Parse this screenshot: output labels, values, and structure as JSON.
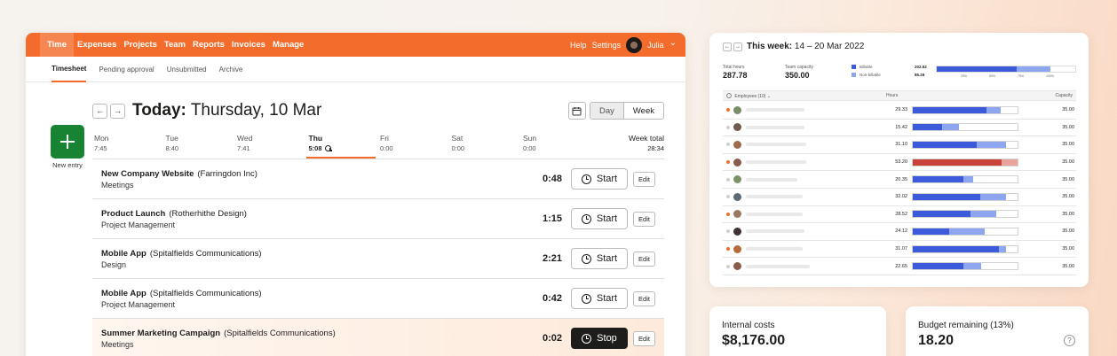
{
  "nav": {
    "tabs": [
      "Time",
      "Expenses",
      "Projects",
      "Team",
      "Reports",
      "Invoices",
      "Manage"
    ],
    "active_tab": "Time",
    "right": {
      "help": "Help",
      "settings": "Settings",
      "user": "Julia",
      "caret": "⌄"
    }
  },
  "subnav": {
    "items": [
      "Timesheet",
      "Pending approval",
      "Unsubmitted",
      "Archive"
    ],
    "active": "Timesheet"
  },
  "new_entry": {
    "label": "New entry"
  },
  "daybar": {
    "prev": "←",
    "next": "→",
    "today_label": "Today:",
    "date": "Thursday, 10 Mar",
    "view_day": "Day",
    "view_week": "Week"
  },
  "days": [
    {
      "name": "Mon",
      "time": "7:45"
    },
    {
      "name": "Tue",
      "time": "8:40"
    },
    {
      "name": "Wed",
      "time": "7:41"
    },
    {
      "name": "Thu",
      "time": "5:08"
    },
    {
      "name": "Fri",
      "time": "0:00"
    },
    {
      "name": "Sat",
      "time": "0:00"
    },
    {
      "name": "Sun",
      "time": "0:00"
    }
  ],
  "week_total": {
    "label": "Week total",
    "time": "28:34"
  },
  "entries": [
    {
      "project": "New Company Website",
      "client": "(Farringdon Inc)",
      "task": "Meetings",
      "duration": "0:48",
      "button": "Start",
      "edit": "Edit"
    },
    {
      "project": "Product Launch",
      "client": "(Rotherhithe Design)",
      "task": "Project Management",
      "duration": "1:15",
      "button": "Start",
      "edit": "Edit"
    },
    {
      "project": "Mobile App",
      "client": "(Spitalfields Communications)",
      "task": "Design",
      "duration": "2:21",
      "button": "Start",
      "edit": "Edit"
    },
    {
      "project": "Mobile App",
      "client": "(Spitalfields Communications)",
      "task": "Project Management",
      "duration": "0:42",
      "button": "Start",
      "edit": "Edit"
    },
    {
      "project": "Summer Marketing Campaign",
      "client": "(Spitalfields Communications)",
      "task": "Meetings",
      "duration": "0:02",
      "button": "Stop",
      "edit": "Edit"
    }
  ],
  "report": {
    "prev": "←",
    "next": "→",
    "title_bold": "This week:",
    "title_range": "14 – 20 Mar 2022",
    "total_hours_label": "Total hours",
    "total_hours": "287.78",
    "capacity_label": "Team capacity",
    "capacity": "350.00",
    "billable_label": "Billable",
    "billable": "202.52",
    "nonbillable_label": "Non-billable",
    "nonbillable": "85.26",
    "summary_ticks": [
      "25%",
      "50%",
      "75%",
      "100%"
    ],
    "summary_billable_pct": 57.9,
    "summary_nonbillable_pct": 24.4,
    "col_employees": "Employees (10)",
    "col_hours": "Hours",
    "col_capacity": "Capacity",
    "rows": [
      {
        "hours": "29.33",
        "capacity": "35.00",
        "billable": 0.7,
        "nonbillable": 0.14,
        "over": 0,
        "status": "#f36c2b",
        "name_w": 66
      },
      {
        "hours": "15.42",
        "capacity": "35.00",
        "billable": 0.28,
        "nonbillable": 0.16,
        "over": 0,
        "status": "#cfcfcf",
        "name_w": 66
      },
      {
        "hours": "31.10",
        "capacity": "35.00",
        "billable": 0.61,
        "nonbillable": 0.28,
        "over": 0,
        "status": "#cfcfcf",
        "name_w": 68
      },
      {
        "hours": "53.20",
        "capacity": "35.00",
        "billable": 0.85,
        "nonbillable": 0,
        "over": 0.15,
        "status": "#f36c2b",
        "name_w": 68
      },
      {
        "hours": "20.35",
        "capacity": "35.00",
        "billable": 0.48,
        "nonbillable": 0.1,
        "over": 0,
        "status": "#cfcfcf",
        "name_w": 58
      },
      {
        "hours": "32.02",
        "capacity": "35.00",
        "billable": 0.64,
        "nonbillable": 0.25,
        "over": 0,
        "status": "#cfcfcf",
        "name_w": 64
      },
      {
        "hours": "28.52",
        "capacity": "35.00",
        "billable": 0.55,
        "nonbillable": 0.25,
        "over": 0,
        "status": "#f36c2b",
        "name_w": 64
      },
      {
        "hours": "24.12",
        "capacity": "35.00",
        "billable": 0.35,
        "nonbillable": 0.34,
        "over": 0,
        "status": "#cfcfcf",
        "name_w": 66
      },
      {
        "hours": "31.07",
        "capacity": "35.00",
        "billable": 0.82,
        "nonbillable": 0.07,
        "over": 0,
        "status": "#f36c2b",
        "name_w": 64
      },
      {
        "hours": "22.65",
        "capacity": "35.00",
        "billable": 0.48,
        "nonbillable": 0.17,
        "over": 0,
        "status": "#cfcfcf",
        "name_w": 72
      }
    ]
  },
  "cards": {
    "internal_costs_label": "Internal costs",
    "internal_costs": "$8,176.00",
    "budget_label": "Budget remaining (13%)",
    "budget": "18.20",
    "help": "?"
  },
  "colors": {
    "brand": "#f36c2b",
    "billable": "#3b5bdb",
    "nonbillable": "#8ea6ef",
    "over": "#c9423a",
    "over_light": "#e8a39b",
    "new_entry": "#188433"
  }
}
